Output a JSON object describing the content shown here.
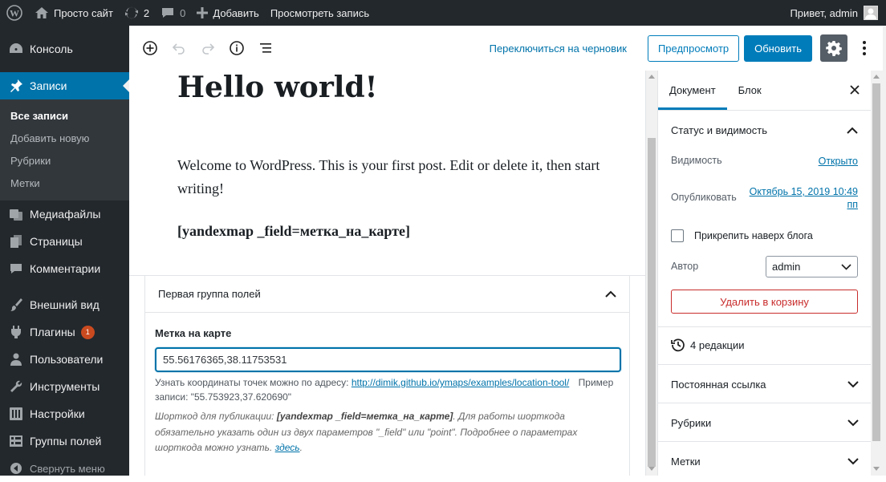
{
  "adminbar": {
    "site_name": "Просто сайт",
    "updates_count": "2",
    "comments_count": "0",
    "add_new": "Добавить",
    "view_post": "Просмотреть запись",
    "greeting": "Привет, admin"
  },
  "sidebar": {
    "items": [
      {
        "label": "Консоль",
        "icon": "dashboard-icon"
      },
      {
        "label": "Записи",
        "icon": "pin-icon"
      },
      {
        "label": "Медиафайлы",
        "icon": "media-icon"
      },
      {
        "label": "Страницы",
        "icon": "pages-icon"
      },
      {
        "label": "Комментарии",
        "icon": "comments-icon"
      },
      {
        "label": "Внешний вид",
        "icon": "appearance-icon"
      },
      {
        "label": "Плагины",
        "icon": "plugins-icon",
        "badge": "1"
      },
      {
        "label": "Пользователи",
        "icon": "users-icon"
      },
      {
        "label": "Инструменты",
        "icon": "tools-icon"
      },
      {
        "label": "Настройки",
        "icon": "settings-icon"
      },
      {
        "label": "Группы полей",
        "icon": "field-groups-icon"
      }
    ],
    "submenu": [
      "Все записи",
      "Добавить новую",
      "Рубрики",
      "Метки"
    ],
    "collapse": "Свернуть меню"
  },
  "toolbar": {
    "switch_draft": "Переключиться на черновик",
    "preview": "Предпросмотр",
    "update": "Обновить"
  },
  "post": {
    "title": "Hello world!",
    "paragraph": "Welcome to WordPress. This is your first post. Edit or delete it, then start writing!",
    "shortcode": "[yandexmap _field=метка_на_карте]"
  },
  "metabox": {
    "title": "Первая группа полей",
    "field_label": "Метка на карте",
    "field_value": "55.56176365,38.11753531",
    "help_prefix": "Узнать координаты точек можно по адресу: ",
    "help_link": "http://dimik.github.io/ymaps/examples/location-tool/",
    "help_example": "Пример записи: \"55.753923,37.620690\"",
    "note_prefix": "Шорткод для публикации: ",
    "note_shortcode": "[yandexmap _field=метка_на_карте]",
    "note_text": ". Для работы шорткода обязательно указать один из двух параметров \"_field\" или \"point\". Подробнее о параметрах шорткода можно узнать. ",
    "note_link": "здесь",
    "note_end": "."
  },
  "settings": {
    "tab_document": "Документ",
    "tab_block": "Блок",
    "status_title": "Статус и видимость",
    "visibility_label": "Видимость",
    "visibility_value": "Открыто",
    "published_label": "Опубликовать",
    "published_value": "Октябрь 15, 2019 10:49 пп",
    "sticky_label": "Прикрепить наверх блога",
    "author_label": "Автор",
    "author_value": "admin",
    "trash": "Удалить в корзину",
    "revisions": "4 редакции",
    "permalink": "Постоянная ссылка",
    "categories": "Рубрики",
    "tags": "Метки"
  },
  "colors": {
    "accent": "#0073aa",
    "button": "#007cba",
    "admin_dark": "#23282d",
    "danger": "#c92c2c",
    "badge": "#ca4a1f"
  }
}
